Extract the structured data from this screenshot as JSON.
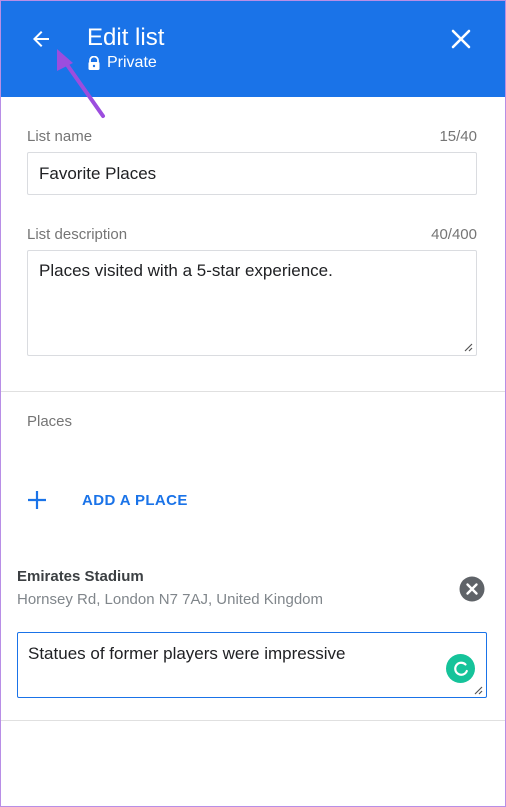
{
  "header": {
    "title": "Edit list",
    "privacy": "Private",
    "back_icon": "arrow-left-icon",
    "close_icon": "close-icon",
    "lock_icon": "lock-icon",
    "background_color": "#1a73e8"
  },
  "form": {
    "name_label": "List name",
    "name_counter": "15/40",
    "name_value": "Favorite Places",
    "description_label": "List description",
    "description_counter": "40/400",
    "description_value": "Places visited with a 5-star experience."
  },
  "places": {
    "section_title": "Places",
    "add_label": "ADD A PLACE",
    "add_icon": "plus-icon",
    "accent_color": "#1a73e8",
    "items": [
      {
        "name": "Emirates Stadium",
        "address": "Hornsey Rd, London N7 7AJ, United Kingdom",
        "note": "Statues of former players were impressive",
        "remove_icon": "remove-circle-icon"
      }
    ]
  },
  "annotation": {
    "arrow_color": "#9c4dde"
  }
}
